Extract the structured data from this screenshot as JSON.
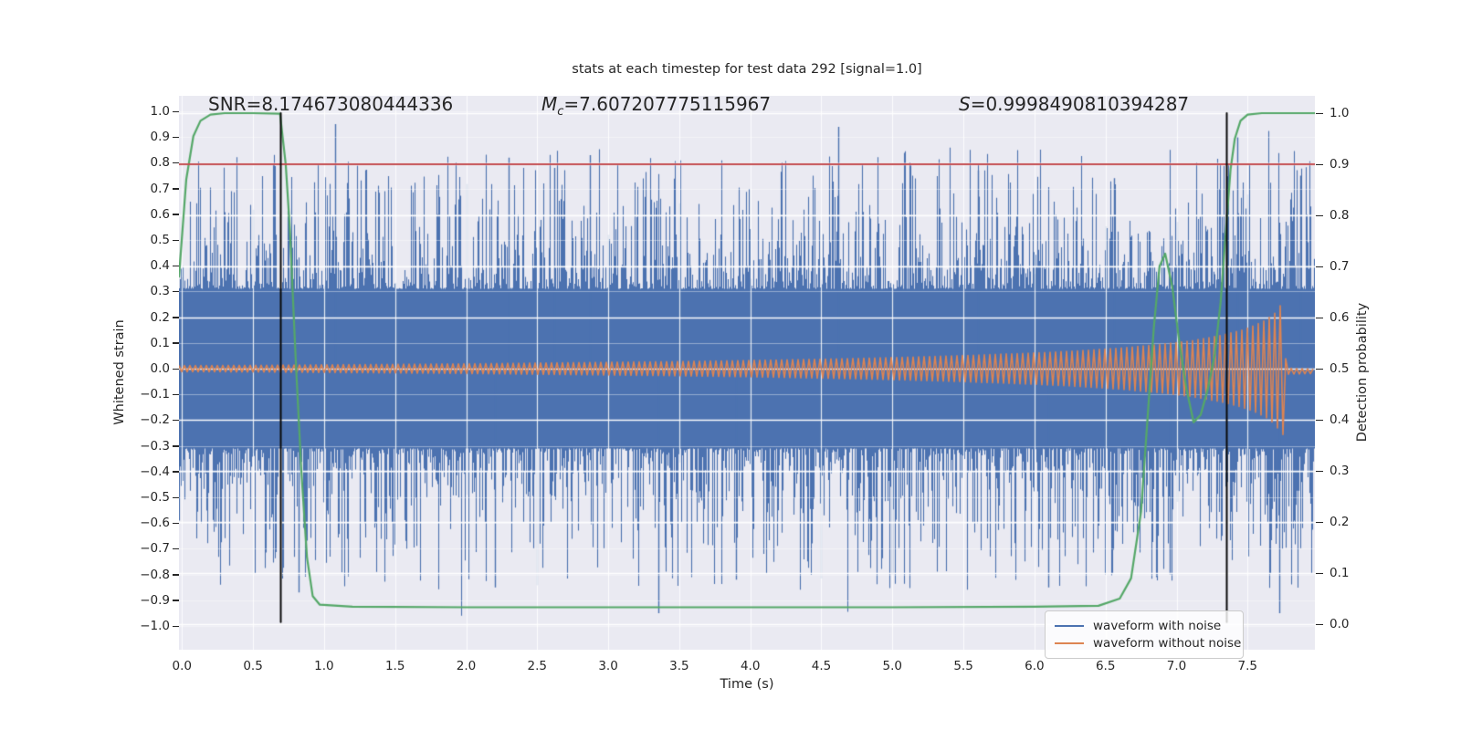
{
  "title": "stats at each timestep for test data 292 [signal=1.0]",
  "annotations": {
    "snr": {
      "label": "SNR",
      "value": "=8.174673080444336"
    },
    "chirp_mass": {
      "symbol": "M",
      "subscript": "c",
      "value": "=7.607207775115967"
    },
    "significance": {
      "symbol": "S",
      "value": "=0.9998490810394287"
    }
  },
  "axes": {
    "x": {
      "label": "Time (s)",
      "ticks": [
        "0.0",
        "0.5",
        "1.0",
        "1.5",
        "2.0",
        "2.5",
        "3.0",
        "3.5",
        "4.0",
        "4.5",
        "5.0",
        "5.5",
        "6.0",
        "6.5",
        "7.0",
        "7.5"
      ],
      "tick_values": [
        0,
        0.5,
        1,
        1.5,
        2,
        2.5,
        3,
        3.5,
        4,
        4.5,
        5,
        5.5,
        6,
        6.5,
        7,
        7.5
      ],
      "range": [
        -0.021,
        7.974
      ]
    },
    "y_left": {
      "label": "Whitened strain",
      "ticks": [
        "1.0",
        "0.9",
        "0.8",
        "0.7",
        "0.6",
        "0.5",
        "0.4",
        "0.3",
        "0.2",
        "0.1",
        "0.0",
        "−0.1",
        "−0.2",
        "−0.3",
        "−0.4",
        "−0.5",
        "−0.6",
        "−0.7",
        "−0.8",
        "−0.9",
        "−1.0"
      ],
      "tick_values": [
        1,
        0.9,
        0.8,
        0.7,
        0.6,
        0.5,
        0.4,
        0.3,
        0.2,
        0.1,
        0,
        -0.1,
        -0.2,
        -0.3,
        -0.4,
        -0.5,
        -0.6,
        -0.7,
        -0.8,
        -0.9,
        -1
      ],
      "range": [
        -1.06,
        1.06
      ]
    },
    "y_right": {
      "label": "Detection probability",
      "ticks": [
        "1.0",
        "0.9",
        "0.8",
        "0.7",
        "0.6",
        "0.5",
        "0.4",
        "0.3",
        "0.2",
        "0.1",
        "0.0"
      ],
      "tick_values": [
        1,
        0.9,
        0.8,
        0.7,
        0.6,
        0.5,
        0.4,
        0.3,
        0.2,
        0.1,
        0
      ],
      "range": [
        -0.034,
        1.03
      ]
    }
  },
  "legend": {
    "items": [
      {
        "label": "waveform with noise",
        "color": "#4c72b0"
      },
      {
        "label": "waveform without noise",
        "color": "#dd8452"
      }
    ]
  },
  "colors": {
    "plot_bg": "#eaeaf2",
    "grid": "#ffffff",
    "noise_blue": "#4c72b0",
    "signal_orange": "#dd8452",
    "probability_green": "#55a868",
    "threshold_red": "#c44e52",
    "event_line_black": "#0a0a0a",
    "text": "#262626"
  },
  "chart_data": {
    "type": "line",
    "title": "stats at each timestep for test data 292 [signal=1.0]",
    "xlabel": "Time (s)",
    "ylabel_left": "Whitened strain",
    "ylabel_right": "Detection probability",
    "x_range_seconds": [
      0,
      7.97
    ],
    "stats": {
      "SNR": 8.174673080444336,
      "Mc": 7.607207775115967,
      "S": 0.9998490810394287
    },
    "threshold_line": {
      "axis": "right",
      "value": 0.9,
      "color": "#c44e52"
    },
    "event_lines": {
      "times": [
        0.69,
        7.35
      ],
      "color": "#0a0a0a",
      "y_span_left_axis": [
        -0.985,
        0.993
      ]
    },
    "series": [
      {
        "name": "waveform with noise",
        "color": "#4c72b0",
        "axis": "left",
        "kind": "noise",
        "approx_std": 0.21,
        "solid_core": 0.31,
        "seed": 1337,
        "notable_spikes": [
          [
            0.82,
            -0.87
          ],
          [
            1.08,
            0.95
          ],
          [
            2.2,
            -0.85
          ],
          [
            2.3,
            0.82
          ],
          [
            2.62,
            0.78
          ],
          [
            2.87,
            0.83
          ],
          [
            3.35,
            -0.95
          ],
          [
            3.9,
            -0.82
          ],
          [
            4.62,
            0.94
          ],
          [
            5.0,
            -0.8
          ],
          [
            5.6,
            0.77
          ],
          [
            6.1,
            -0.85
          ],
          [
            6.56,
            0.74
          ],
          [
            6.95,
            -0.8
          ],
          [
            7.43,
            0.9
          ],
          [
            7.72,
            -0.95
          ],
          [
            7.87,
            0.75
          ]
        ]
      },
      {
        "name": "waveform without noise",
        "color": "#dd8452",
        "axis": "left",
        "kind": "chirp",
        "center": 0.0,
        "post_merger_offset": -0.01,
        "merger_time": 7.755,
        "envelope": [
          [
            0,
            0.012
          ],
          [
            0.5,
            0.013
          ],
          [
            1,
            0.015
          ],
          [
            1.5,
            0.017
          ],
          [
            2,
            0.019
          ],
          [
            2.5,
            0.022
          ],
          [
            3,
            0.025
          ],
          [
            3.5,
            0.028
          ],
          [
            4,
            0.032
          ],
          [
            4.5,
            0.037
          ],
          [
            5,
            0.043
          ],
          [
            5.5,
            0.051
          ],
          [
            6,
            0.061
          ],
          [
            6.3,
            0.069
          ],
          [
            6.6,
            0.08
          ],
          [
            6.9,
            0.095
          ],
          [
            7.1,
            0.108
          ],
          [
            7.3,
            0.128
          ],
          [
            7.45,
            0.148
          ],
          [
            7.55,
            0.168
          ],
          [
            7.63,
            0.19
          ],
          [
            7.69,
            0.215
          ],
          [
            7.73,
            0.245
          ],
          [
            7.755,
            0.26
          ],
          [
            7.765,
            0.05
          ],
          [
            7.775,
            0.012
          ],
          [
            7.97,
            0.009
          ]
        ]
      },
      {
        "name": "detection probability",
        "color": "#55a868",
        "axis": "right",
        "kind": "line",
        "points": [
          [
            -0.021,
            0.68
          ],
          [
            0.03,
            0.87
          ],
          [
            0.08,
            0.955
          ],
          [
            0.13,
            0.985
          ],
          [
            0.2,
            0.997
          ],
          [
            0.3,
            1.0
          ],
          [
            0.5,
            1.0
          ],
          [
            0.69,
            0.999
          ],
          [
            0.73,
            0.9
          ],
          [
            0.76,
            0.77
          ],
          [
            0.8,
            0.52
          ],
          [
            0.84,
            0.3
          ],
          [
            0.88,
            0.13
          ],
          [
            0.92,
            0.055
          ],
          [
            0.97,
            0.038
          ],
          [
            1.2,
            0.034
          ],
          [
            2,
            0.033
          ],
          [
            3,
            0.033
          ],
          [
            4,
            0.033
          ],
          [
            5,
            0.033
          ],
          [
            6,
            0.034
          ],
          [
            6.45,
            0.036
          ],
          [
            6.6,
            0.05
          ],
          [
            6.68,
            0.09
          ],
          [
            6.75,
            0.22
          ],
          [
            6.8,
            0.42
          ],
          [
            6.84,
            0.58
          ],
          [
            6.88,
            0.7
          ],
          [
            6.92,
            0.725
          ],
          [
            6.97,
            0.66
          ],
          [
            7.02,
            0.55
          ],
          [
            7.07,
            0.46
          ],
          [
            7.12,
            0.395
          ],
          [
            7.17,
            0.41
          ],
          [
            7.22,
            0.46
          ],
          [
            7.27,
            0.53
          ],
          [
            7.31,
            0.63
          ],
          [
            7.35,
            0.78
          ],
          [
            7.38,
            0.89
          ],
          [
            7.41,
            0.95
          ],
          [
            7.45,
            0.985
          ],
          [
            7.5,
            0.997
          ],
          [
            7.6,
            1.0
          ],
          [
            7.97,
            1.0
          ]
        ]
      }
    ]
  }
}
